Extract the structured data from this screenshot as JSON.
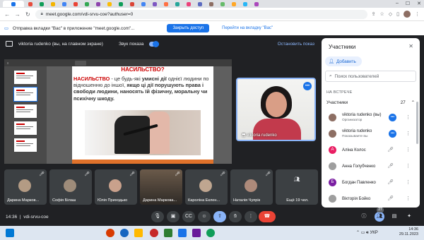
{
  "browser": {
    "url": "meet.google.com/vdi-srvu-coe?authuser=0",
    "tab_colors": [
      "#1a73e8",
      "#e74c3c",
      "#0f9d58",
      "#f4b400",
      "#4285f4",
      "#ea4335",
      "#34a853",
      "#8e44ad",
      "#fbbc05",
      "#0f9d58",
      "#db4437",
      "#4285f4",
      "#7e57c2",
      "#ff7043",
      "#26a69a",
      "#ec407a",
      "#5c6bc0",
      "#8d6e63",
      "#66bb6a",
      "#ffa726",
      "#29b6f6",
      "#ab47bc"
    ]
  },
  "infobar": {
    "message": "Отправка вкладки \"Вас\" в приложение \"meet.google.com\"...",
    "open_button": "Закрыть доступ",
    "link": "Перейти на вкладку \"Вас\""
  },
  "meet_top": {
    "presenter": "viktoria rudenko (вы, на главном экране)",
    "sound_label": "Звук показа",
    "stop_label": "Остановить показ"
  },
  "slide": {
    "title": "НАСИЛЬСТВО?",
    "red_word": "НАСИЛЬСТВО",
    "text_1": " - це будь-які ",
    "bold_1": "умисні дії",
    "text_2": " однієї людини по відношенню до іншої, ",
    "bold_2": "якщо ці дії порушують права і свободи людини, наносять їй фізичну, моральну чи психічну шкоду."
  },
  "self_view": {
    "name": "viktoria rudenko"
  },
  "tiles": [
    {
      "name": "Дарина Марков..."
    },
    {
      "name": "Софія Білаш"
    },
    {
      "name": "Юлія Приходько"
    },
    {
      "name": "Дарина Маркова..."
    },
    {
      "name": "Кароліна Еклен..."
    },
    {
      "name": "Наталія Чупрік"
    },
    {
      "name": "Ещё 19 чел."
    }
  ],
  "controls": {
    "time": "14:36",
    "meeting_code": "vdi-srvu-coe",
    "participant_badge": "27"
  },
  "panel": {
    "title": "Участники",
    "add_label": "Добавить",
    "search_placeholder": "Поиск пользователей",
    "section": "НА ВСТРЕЧЕ",
    "group_label": "Участники",
    "group_count": "27",
    "people": [
      {
        "name": "viktoria rudenko (вы)",
        "role": "Организатор",
        "color": "#8d6e63",
        "initial": ""
      },
      {
        "name": "viktoria rudenko",
        "role": "Показываете вы",
        "color": "#8d6e63",
        "initial": ""
      },
      {
        "name": "Аліна Колос",
        "role": "",
        "color": "#e91e63",
        "initial": "А"
      },
      {
        "name": "Анна Голубченко",
        "role": "",
        "color": "#9e9e9e",
        "initial": ""
      },
      {
        "name": "Богдан Павленко",
        "role": "",
        "color": "#7b1fa2",
        "initial": "Б"
      },
      {
        "name": "Вікторія Бойко",
        "role": "",
        "color": "#9e9e9e",
        "initial": ""
      }
    ]
  },
  "taskbar": {
    "lang": "УКР",
    "time": "14:36",
    "date": "29.11.2023"
  }
}
